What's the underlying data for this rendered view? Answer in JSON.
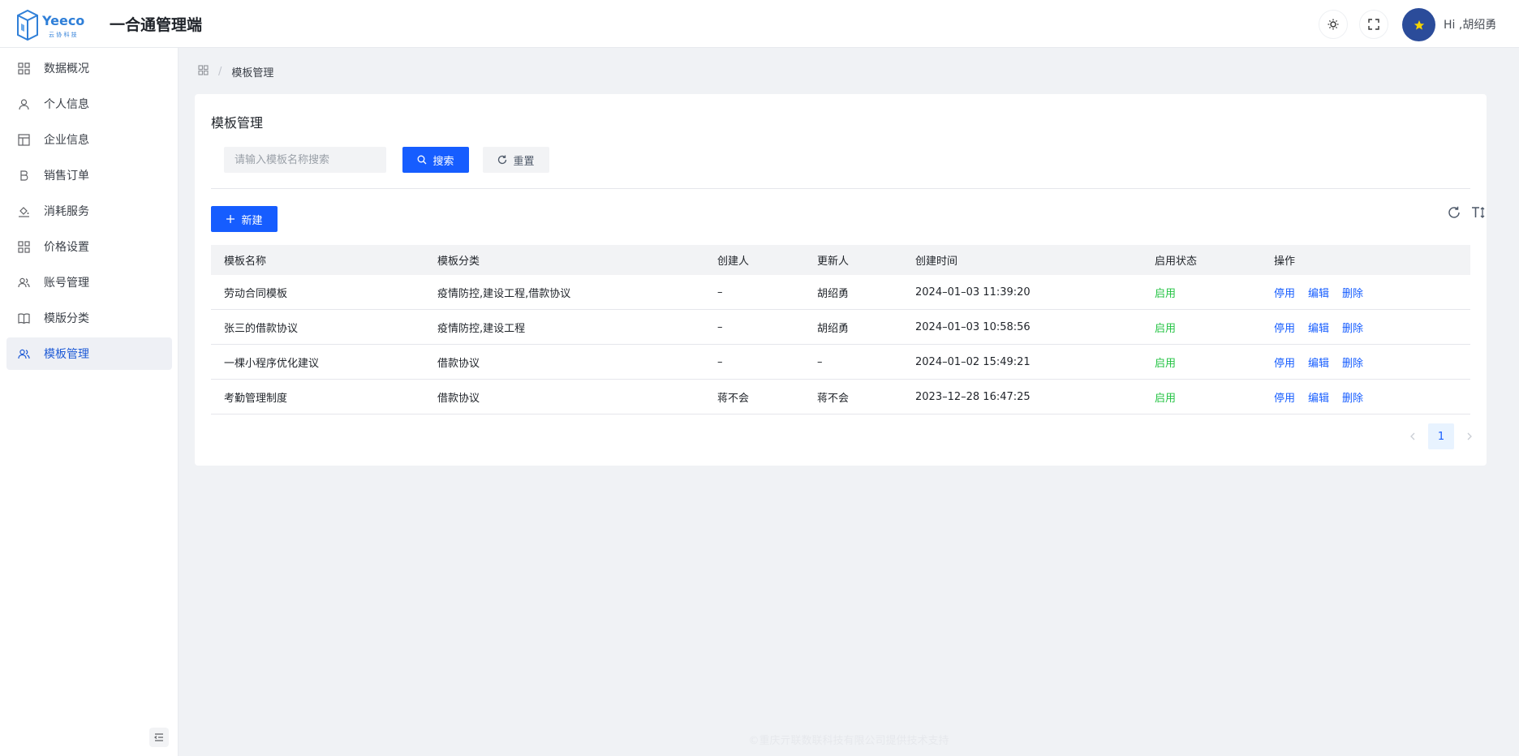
{
  "header": {
    "logo_text": "Yeeco",
    "logo_subtext": "云 协 科 技",
    "app_title": "一合通管理端",
    "greeting": "Hi ,胡绍勇"
  },
  "sidebar": {
    "items": [
      {
        "label": "数据概况",
        "icon": "grid-icon"
      },
      {
        "label": "个人信息",
        "icon": "user-icon"
      },
      {
        "label": "企业信息",
        "icon": "layout-icon"
      },
      {
        "label": "销售订单",
        "icon": "bold-b-icon"
      },
      {
        "label": "消耗服务",
        "icon": "bucket-icon"
      },
      {
        "label": "价格设置",
        "icon": "grid-icon"
      },
      {
        "label": "账号管理",
        "icon": "user-group-icon"
      },
      {
        "label": "模版分类",
        "icon": "book-icon"
      },
      {
        "label": "模板管理",
        "icon": "user-group-icon",
        "active": true
      }
    ]
  },
  "breadcrumb": {
    "current": "模板管理"
  },
  "main": {
    "title": "模板管理",
    "search": {
      "placeholder": "请输入模板名称搜索",
      "search_label": "搜索",
      "reset_label": "重置"
    },
    "new_label": "新建",
    "table": {
      "headers": [
        "模板名称",
        "模板分类",
        "创建人",
        "更新人",
        "创建时间",
        "启用状态",
        "操作"
      ],
      "rows": [
        {
          "name": "劳动合同模板",
          "category": "疫情防控,建设工程,借款协议",
          "creator": "–",
          "updater": "胡绍勇",
          "created": "2024–01–03 11:39:20",
          "status": "启用"
        },
        {
          "name": "张三的借款协议",
          "category": "疫情防控,建设工程",
          "creator": "–",
          "updater": "胡绍勇",
          "created": "2024–01–03 10:58:56",
          "status": "启用"
        },
        {
          "name": "一棵小程序优化建议",
          "category": "借款协议",
          "creator": "–",
          "updater": "–",
          "created": "2024–01–02 15:49:21",
          "status": "启用"
        },
        {
          "name": "考勤管理制度",
          "category": "借款协议",
          "creator": "蒋不会",
          "updater": "蒋不会",
          "created": "2023–12–28 16:47:25",
          "status": "启用"
        }
      ],
      "actions": [
        "停用",
        "编辑",
        "删除"
      ]
    },
    "pagination": {
      "current_page": "1"
    }
  },
  "footer": {
    "text": "©重庆亓联数联科技有限公司提供技术支持"
  },
  "colors": {
    "primary": "#165dff",
    "status_enabled": "#23c343",
    "active_menu_bg": "#eef0f5"
  }
}
